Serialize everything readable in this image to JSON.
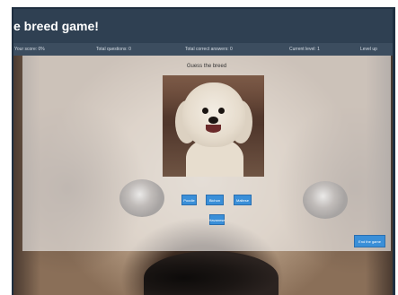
{
  "header": {
    "title": "e breed game!"
  },
  "stats": {
    "score": "Your score: 0%",
    "total_questions": "Total questions: 0",
    "total_correct": "Total correct answers: 0",
    "current_level": "Current level: 1",
    "level_up": "Level up"
  },
  "game": {
    "prompt": "Guess the breed",
    "answers": [
      "Poodle",
      "Bichon",
      "Maltese",
      "Havanese"
    ],
    "end_button": "End the game"
  },
  "colors": {
    "header_bg": "#2f4052",
    "stats_bg": "#3c4d5f",
    "button_blue": "#3a8fd8"
  }
}
